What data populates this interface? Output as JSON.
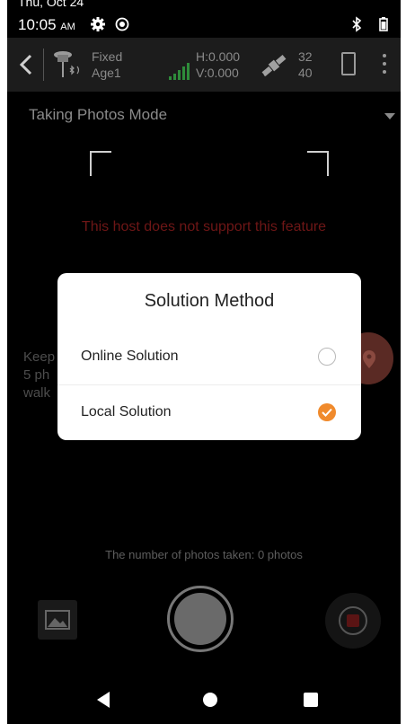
{
  "status_bar": {
    "date": "Thu, Oct 24",
    "time": "10:05",
    "ampm": "AM"
  },
  "toolbar": {
    "fix_status": "Fixed",
    "age": "Age1",
    "h_value": "H:0.000",
    "v_value": "V:0.000",
    "sat_count_a": "32",
    "sat_count_b": "40"
  },
  "mode": {
    "label": "Taking Photos Mode"
  },
  "warning": "This host does not support this feature",
  "hint_lines": [
    "Keep",
    "5 ph",
    "walk"
  ],
  "photo_count": "The number of photos taken: 0 photos",
  "dialog": {
    "title": "Solution Method",
    "options": [
      {
        "label": "Online Solution",
        "selected": false
      },
      {
        "label": "Local Solution",
        "selected": true
      }
    ]
  },
  "colors": {
    "accent": "#f08a2c",
    "warning": "#6e1616",
    "signal": "#2e8b3a"
  }
}
